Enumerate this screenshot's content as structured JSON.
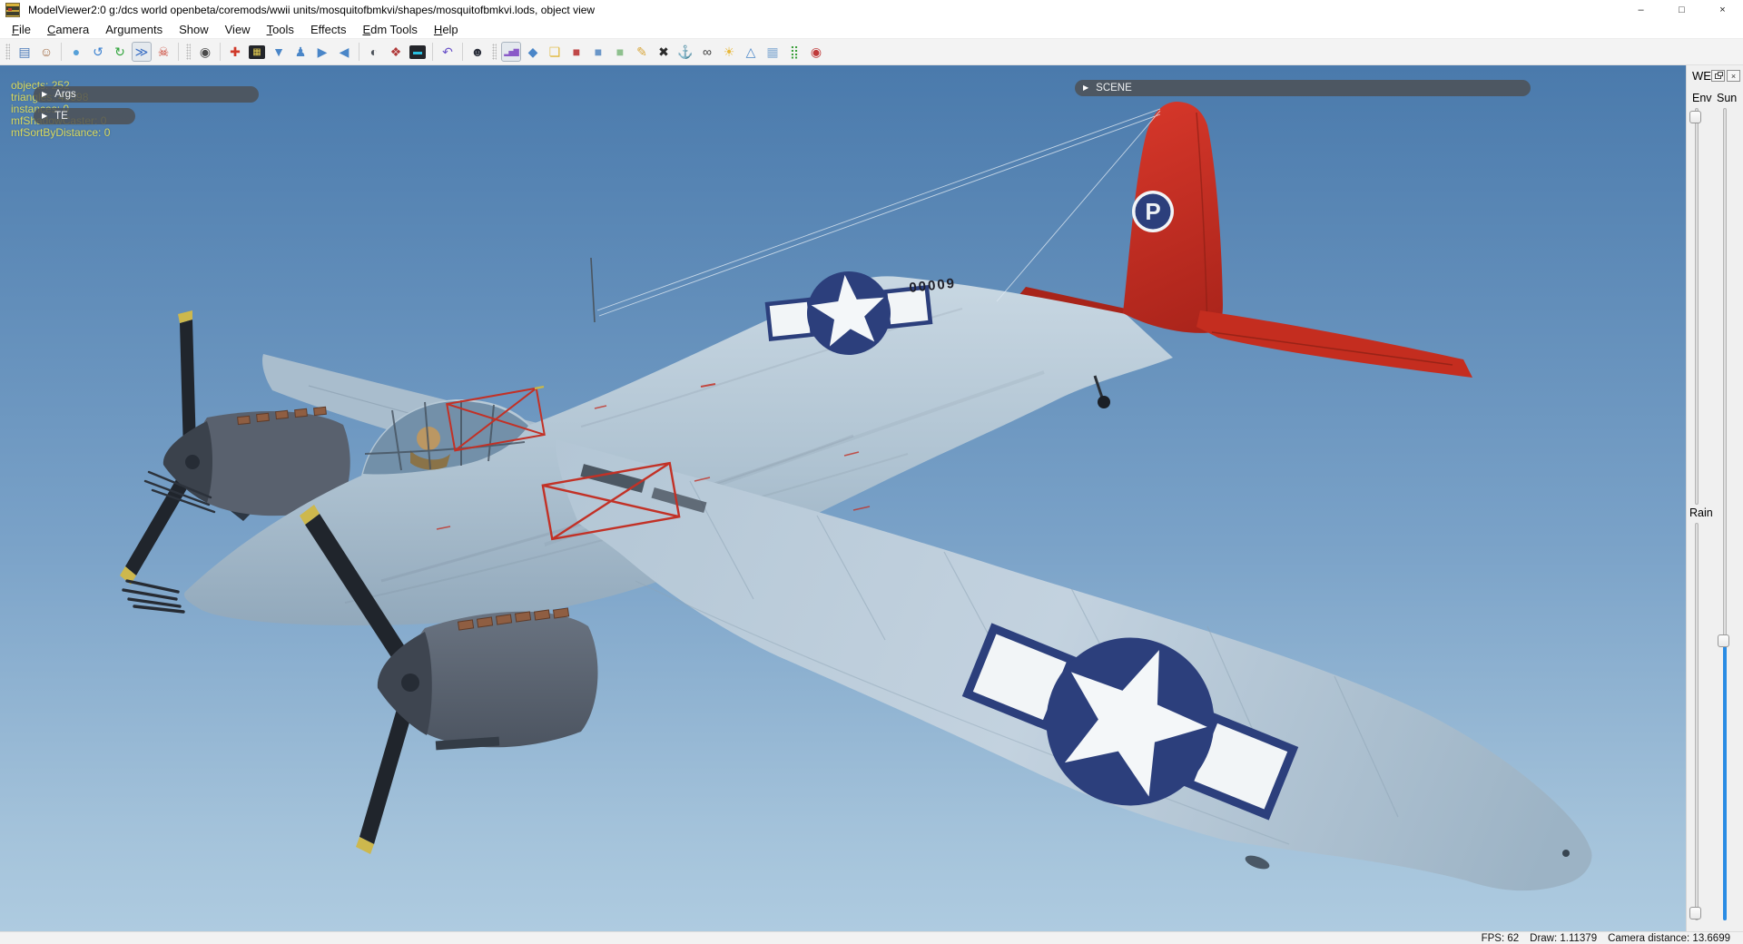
{
  "window": {
    "title": "ModelViewer2:0 g:/dcs world openbeta/coremods/wwii units/mosquitofbmkvi/shapes/mosquitofbmkvi.lods, object view",
    "minimize_glyph": "–",
    "maximize_glyph": "□",
    "close_glyph": "×"
  },
  "menu": {
    "items": [
      {
        "label": "File",
        "u": 0
      },
      {
        "label": "Camera",
        "u": 0
      },
      {
        "label": "Arguments",
        "u": -1
      },
      {
        "label": "Show",
        "u": -1
      },
      {
        "label": "View",
        "u": -1
      },
      {
        "label": "Tools",
        "u": 0
      },
      {
        "label": "Effects",
        "u": -1
      },
      {
        "label": "Edm Tools",
        "u": 0
      },
      {
        "label": "Help",
        "u": 0
      }
    ]
  },
  "toolbar": {
    "items": [
      {
        "t": "grip"
      },
      {
        "t": "icon",
        "name": "open-file-icon",
        "g": "▤",
        "c": "#4a7ab8"
      },
      {
        "t": "icon",
        "name": "add-user-icon",
        "g": "☺",
        "c": "#a06a42"
      },
      {
        "t": "sep"
      },
      {
        "t": "icon",
        "name": "globe-icon",
        "g": "●",
        "c": "#56a0d8"
      },
      {
        "t": "icon",
        "name": "rotate-ccw-icon",
        "g": "↺",
        "c": "#3a80d0"
      },
      {
        "t": "icon",
        "name": "refresh-icon",
        "g": "↻",
        "c": "#2fa43a"
      },
      {
        "t": "icon",
        "name": "fast-forward-box-icon",
        "g": "≫",
        "c": "#3a6fc4",
        "cls": "pressed"
      },
      {
        "t": "icon",
        "name": "skeleton-icon",
        "g": "☠",
        "c": "#c83a2a"
      },
      {
        "t": "sep"
      },
      {
        "t": "grip"
      },
      {
        "t": "icon",
        "name": "webcam-icon",
        "g": "◉",
        "c": "#4a4a4a"
      },
      {
        "t": "sep"
      },
      {
        "t": "icon",
        "name": "pivot-point-icon",
        "g": "✚",
        "c": "#d03a2a"
      },
      {
        "t": "icon",
        "name": "uv-grid-icon",
        "g": "▦",
        "c": "#e8d052",
        "cls": "dark"
      },
      {
        "t": "icon",
        "name": "cone-filter-icon",
        "g": "▼",
        "c": "#4a86c8"
      },
      {
        "t": "icon",
        "name": "figure-icon",
        "g": "♟",
        "c": "#4a86c8"
      },
      {
        "t": "icon",
        "name": "play-right-icon",
        "g": "▶",
        "c": "#4a86c8"
      },
      {
        "t": "icon",
        "name": "play-left-icon",
        "g": "◀",
        "c": "#4a86c8"
      },
      {
        "t": "sep"
      },
      {
        "t": "icon",
        "name": "sphere-preview-icon",
        "g": "◐",
        "c": "#4a5058"
      },
      {
        "t": "icon",
        "name": "primitives-icon",
        "g": "❖",
        "c": "#b03a3a"
      },
      {
        "t": "icon",
        "name": "screen-bar-icon",
        "g": "▬",
        "c": "#2ac0e0",
        "cls": "dark"
      },
      {
        "t": "sep"
      },
      {
        "t": "icon",
        "name": "undo-icon",
        "g": "↶",
        "c": "#6a52c8"
      },
      {
        "t": "sep"
      },
      {
        "t": "icon",
        "name": "penguin-icon",
        "g": "☻",
        "c": "#2a2e3a"
      },
      {
        "t": "grip"
      },
      {
        "t": "icon",
        "name": "bar-chart-icon",
        "g": "▂▅▇",
        "c": "#8a5ac8",
        "cls": "pressed multi"
      },
      {
        "t": "icon",
        "name": "gem-icon",
        "g": "◆",
        "c": "#4a86c8"
      },
      {
        "t": "icon",
        "name": "folder-icon",
        "g": "❏",
        "c": "#e0b83a"
      },
      {
        "t": "icon",
        "name": "red-cube-icon",
        "g": "■",
        "c": "#c04848"
      },
      {
        "t": "icon",
        "name": "blue-cube-icon",
        "g": "■",
        "c": "#6a96c8"
      },
      {
        "t": "icon",
        "name": "green-cube-icon",
        "g": "■",
        "c": "#8ec08e"
      },
      {
        "t": "icon",
        "name": "measure-icon",
        "g": "✎",
        "c": "#d8a63a"
      },
      {
        "t": "icon",
        "name": "bones-icon",
        "g": "✖",
        "c": "#2a2a2a"
      },
      {
        "t": "icon",
        "name": "ship-icon",
        "g": "⚓",
        "c": "#3a5a8a"
      },
      {
        "t": "icon",
        "name": "goggles-icon",
        "g": "∞",
        "c": "#3a3a3a"
      },
      {
        "t": "icon",
        "name": "shell-icon",
        "g": "☀",
        "c": "#e8b83a"
      },
      {
        "t": "icon",
        "name": "pyramid-icon",
        "g": "△",
        "c": "#4a86c8"
      },
      {
        "t": "icon",
        "name": "dot-grid-icon",
        "g": "▦",
        "c": "#8aaed4"
      },
      {
        "t": "icon",
        "name": "green-grid-icon",
        "g": "⣿",
        "c": "#3aa03a"
      },
      {
        "t": "icon",
        "name": "target-icon",
        "g": "◉",
        "c": "#c03a3a"
      }
    ]
  },
  "viewport": {
    "debug_lines": [
      "objects: 252",
      "triangles: 45598",
      "instances: 0",
      "mfShadowCaster: 0",
      "mfSortByDistance: 0"
    ],
    "args_panel_label": "Args",
    "te_panel_label": "TE",
    "scene_panel_label": "SCENE",
    "expand_glyph": "▶"
  },
  "right_panel": {
    "title": "WE...",
    "close_glyph": "×",
    "env_label": "Env",
    "sun_label": "Sun",
    "rain_label": "Rain",
    "slider_fill_color": "#2a8ce4"
  },
  "status_bar": {
    "fps": "FPS: 62",
    "draw": "Draw: 1.11379",
    "camera_distance": "Camera distance: 13.6699"
  },
  "aircraft": {
    "tail_letter": "P",
    "serial_number": "00009",
    "tail_color": "#c22a1e",
    "insignia_color": "#2c3f7c",
    "airframe_color": "#b7c9d7"
  },
  "colors": {
    "sky_top": "#4a7aac",
    "sky_bottom": "#aecbe0",
    "toolbar_bg": "#f3f3f3",
    "panel_bg": "#f0f0f0",
    "overlay_pill": "rgba(77,80,84,0.84)",
    "debug_text": "#d9d95e"
  }
}
